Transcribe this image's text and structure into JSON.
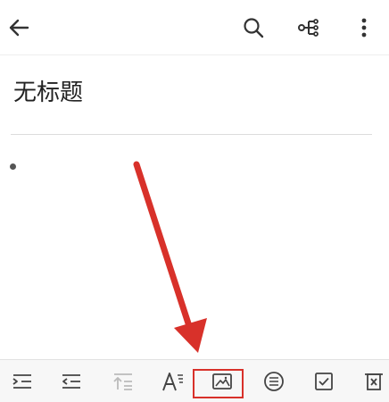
{
  "toolbar": {
    "icons": [
      "back-arrow-icon",
      "search-icon",
      "mind-map-icon",
      "more-vert-icon"
    ]
  },
  "note": {
    "title": "无标题",
    "body": ""
  },
  "format_bar": {
    "icons": [
      "indent-icon",
      "outdent-icon",
      "move-up-icon",
      "text-style-icon",
      "insert-image-icon",
      "list-icon",
      "checkbox-icon",
      "delete-icon"
    ],
    "highlighted": "insert-image-icon",
    "disabled": [
      "move-up-icon"
    ]
  },
  "annotation": {
    "type": "arrow",
    "target": "insert-image-icon",
    "color": "#d8312a"
  }
}
